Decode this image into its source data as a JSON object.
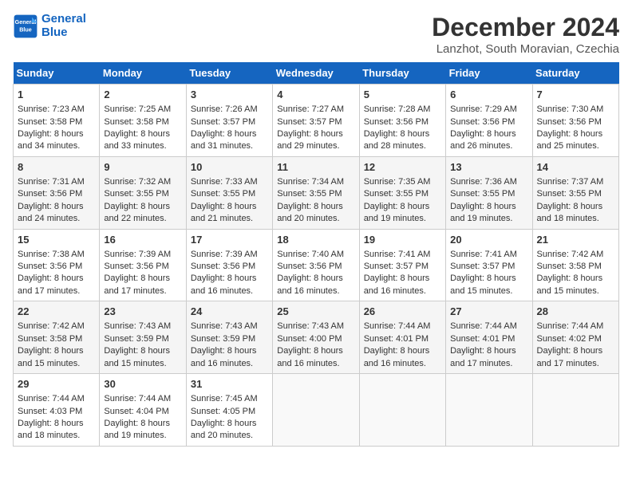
{
  "header": {
    "logo_line1": "General",
    "logo_line2": "Blue",
    "title": "December 2024",
    "subtitle": "Lanzhot, South Moravian, Czechia"
  },
  "weekdays": [
    "Sunday",
    "Monday",
    "Tuesday",
    "Wednesday",
    "Thursday",
    "Friday",
    "Saturday"
  ],
  "weeks": [
    [
      {
        "day": "1",
        "info": "Sunrise: 7:23 AM\nSunset: 3:58 PM\nDaylight: 8 hours\nand 34 minutes."
      },
      {
        "day": "2",
        "info": "Sunrise: 7:25 AM\nSunset: 3:58 PM\nDaylight: 8 hours\nand 33 minutes."
      },
      {
        "day": "3",
        "info": "Sunrise: 7:26 AM\nSunset: 3:57 PM\nDaylight: 8 hours\nand 31 minutes."
      },
      {
        "day": "4",
        "info": "Sunrise: 7:27 AM\nSunset: 3:57 PM\nDaylight: 8 hours\nand 29 minutes."
      },
      {
        "day": "5",
        "info": "Sunrise: 7:28 AM\nSunset: 3:56 PM\nDaylight: 8 hours\nand 28 minutes."
      },
      {
        "day": "6",
        "info": "Sunrise: 7:29 AM\nSunset: 3:56 PM\nDaylight: 8 hours\nand 26 minutes."
      },
      {
        "day": "7",
        "info": "Sunrise: 7:30 AM\nSunset: 3:56 PM\nDaylight: 8 hours\nand 25 minutes."
      }
    ],
    [
      {
        "day": "8",
        "info": "Sunrise: 7:31 AM\nSunset: 3:56 PM\nDaylight: 8 hours\nand 24 minutes."
      },
      {
        "day": "9",
        "info": "Sunrise: 7:32 AM\nSunset: 3:55 PM\nDaylight: 8 hours\nand 22 minutes."
      },
      {
        "day": "10",
        "info": "Sunrise: 7:33 AM\nSunset: 3:55 PM\nDaylight: 8 hours\nand 21 minutes."
      },
      {
        "day": "11",
        "info": "Sunrise: 7:34 AM\nSunset: 3:55 PM\nDaylight: 8 hours\nand 20 minutes."
      },
      {
        "day": "12",
        "info": "Sunrise: 7:35 AM\nSunset: 3:55 PM\nDaylight: 8 hours\nand 19 minutes."
      },
      {
        "day": "13",
        "info": "Sunrise: 7:36 AM\nSunset: 3:55 PM\nDaylight: 8 hours\nand 19 minutes."
      },
      {
        "day": "14",
        "info": "Sunrise: 7:37 AM\nSunset: 3:55 PM\nDaylight: 8 hours\nand 18 minutes."
      }
    ],
    [
      {
        "day": "15",
        "info": "Sunrise: 7:38 AM\nSunset: 3:56 PM\nDaylight: 8 hours\nand 17 minutes."
      },
      {
        "day": "16",
        "info": "Sunrise: 7:39 AM\nSunset: 3:56 PM\nDaylight: 8 hours\nand 17 minutes."
      },
      {
        "day": "17",
        "info": "Sunrise: 7:39 AM\nSunset: 3:56 PM\nDaylight: 8 hours\nand 16 minutes."
      },
      {
        "day": "18",
        "info": "Sunrise: 7:40 AM\nSunset: 3:56 PM\nDaylight: 8 hours\nand 16 minutes."
      },
      {
        "day": "19",
        "info": "Sunrise: 7:41 AM\nSunset: 3:57 PM\nDaylight: 8 hours\nand 16 minutes."
      },
      {
        "day": "20",
        "info": "Sunrise: 7:41 AM\nSunset: 3:57 PM\nDaylight: 8 hours\nand 15 minutes."
      },
      {
        "day": "21",
        "info": "Sunrise: 7:42 AM\nSunset: 3:58 PM\nDaylight: 8 hours\nand 15 minutes."
      }
    ],
    [
      {
        "day": "22",
        "info": "Sunrise: 7:42 AM\nSunset: 3:58 PM\nDaylight: 8 hours\nand 15 minutes."
      },
      {
        "day": "23",
        "info": "Sunrise: 7:43 AM\nSunset: 3:59 PM\nDaylight: 8 hours\nand 15 minutes."
      },
      {
        "day": "24",
        "info": "Sunrise: 7:43 AM\nSunset: 3:59 PM\nDaylight: 8 hours\nand 16 minutes."
      },
      {
        "day": "25",
        "info": "Sunrise: 7:43 AM\nSunset: 4:00 PM\nDaylight: 8 hours\nand 16 minutes."
      },
      {
        "day": "26",
        "info": "Sunrise: 7:44 AM\nSunset: 4:01 PM\nDaylight: 8 hours\nand 16 minutes."
      },
      {
        "day": "27",
        "info": "Sunrise: 7:44 AM\nSunset: 4:01 PM\nDaylight: 8 hours\nand 17 minutes."
      },
      {
        "day": "28",
        "info": "Sunrise: 7:44 AM\nSunset: 4:02 PM\nDaylight: 8 hours\nand 17 minutes."
      }
    ],
    [
      {
        "day": "29",
        "info": "Sunrise: 7:44 AM\nSunset: 4:03 PM\nDaylight: 8 hours\nand 18 minutes."
      },
      {
        "day": "30",
        "info": "Sunrise: 7:44 AM\nSunset: 4:04 PM\nDaylight: 8 hours\nand 19 minutes."
      },
      {
        "day": "31",
        "info": "Sunrise: 7:45 AM\nSunset: 4:05 PM\nDaylight: 8 hours\nand 20 minutes."
      },
      {
        "day": "",
        "info": ""
      },
      {
        "day": "",
        "info": ""
      },
      {
        "day": "",
        "info": ""
      },
      {
        "day": "",
        "info": ""
      }
    ]
  ]
}
